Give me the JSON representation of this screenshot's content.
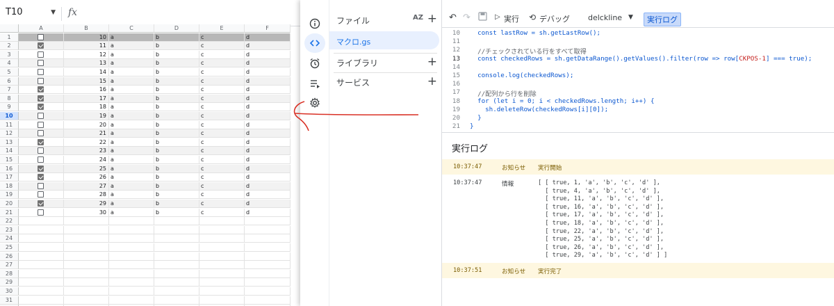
{
  "sheet": {
    "name_box": "T10",
    "fx": "fx",
    "columns": [
      "A",
      "B",
      "C",
      "D",
      "E",
      "F"
    ],
    "rows": [
      {
        "n": "1",
        "checked": false,
        "b": "10",
        "c": "a",
        "d": "b",
        "e": "c",
        "f": "d"
      },
      {
        "n": "2",
        "checked": true,
        "b": "11",
        "c": "a",
        "d": "b",
        "e": "c",
        "f": "d"
      },
      {
        "n": "3",
        "checked": false,
        "b": "12",
        "c": "a",
        "d": "b",
        "e": "c",
        "f": "d"
      },
      {
        "n": "4",
        "checked": false,
        "b": "13",
        "c": "a",
        "d": "b",
        "e": "c",
        "f": "d"
      },
      {
        "n": "5",
        "checked": false,
        "b": "14",
        "c": "a",
        "d": "b",
        "e": "c",
        "f": "d"
      },
      {
        "n": "6",
        "checked": false,
        "b": "15",
        "c": "a",
        "d": "b",
        "e": "c",
        "f": "d"
      },
      {
        "n": "7",
        "checked": true,
        "b": "16",
        "c": "a",
        "d": "b",
        "e": "c",
        "f": "d"
      },
      {
        "n": "8",
        "checked": true,
        "b": "17",
        "c": "a",
        "d": "b",
        "e": "c",
        "f": "d"
      },
      {
        "n": "9",
        "checked": true,
        "b": "18",
        "c": "a",
        "d": "b",
        "e": "c",
        "f": "d"
      },
      {
        "n": "10",
        "checked": false,
        "b": "19",
        "c": "a",
        "d": "b",
        "e": "c",
        "f": "d"
      },
      {
        "n": "11",
        "checked": false,
        "b": "20",
        "c": "a",
        "d": "b",
        "e": "c",
        "f": "d"
      },
      {
        "n": "12",
        "checked": false,
        "b": "21",
        "c": "a",
        "d": "b",
        "e": "c",
        "f": "d"
      },
      {
        "n": "13",
        "checked": true,
        "b": "22",
        "c": "a",
        "d": "b",
        "e": "c",
        "f": "d"
      },
      {
        "n": "14",
        "checked": false,
        "b": "23",
        "c": "a",
        "d": "b",
        "e": "c",
        "f": "d"
      },
      {
        "n": "15",
        "checked": false,
        "b": "24",
        "c": "a",
        "d": "b",
        "e": "c",
        "f": "d"
      },
      {
        "n": "16",
        "checked": true,
        "b": "25",
        "c": "a",
        "d": "b",
        "e": "c",
        "f": "d"
      },
      {
        "n": "17",
        "checked": true,
        "b": "26",
        "c": "a",
        "d": "b",
        "e": "c",
        "f": "d"
      },
      {
        "n": "18",
        "checked": false,
        "b": "27",
        "c": "a",
        "d": "b",
        "e": "c",
        "f": "d"
      },
      {
        "n": "19",
        "checked": false,
        "b": "28",
        "c": "a",
        "d": "b",
        "e": "c",
        "f": "d"
      },
      {
        "n": "20",
        "checked": true,
        "b": "29",
        "c": "a",
        "d": "b",
        "e": "c",
        "f": "d"
      },
      {
        "n": "21",
        "checked": false,
        "b": "30",
        "c": "a",
        "d": "b",
        "e": "c",
        "f": "d"
      },
      {
        "n": "22",
        "checked": null,
        "b": "",
        "c": "",
        "d": "",
        "e": "",
        "f": ""
      },
      {
        "n": "23",
        "checked": null,
        "b": "",
        "c": "",
        "d": "",
        "e": "",
        "f": ""
      },
      {
        "n": "24",
        "checked": null,
        "b": "",
        "c": "",
        "d": "",
        "e": "",
        "f": ""
      },
      {
        "n": "25",
        "checked": null,
        "b": "",
        "c": "",
        "d": "",
        "e": "",
        "f": ""
      },
      {
        "n": "26",
        "checked": null,
        "b": "",
        "c": "",
        "d": "",
        "e": "",
        "f": ""
      },
      {
        "n": "27",
        "checked": null,
        "b": "",
        "c": "",
        "d": "",
        "e": "",
        "f": ""
      },
      {
        "n": "28",
        "checked": null,
        "b": "",
        "c": "",
        "d": "",
        "e": "",
        "f": ""
      },
      {
        "n": "29",
        "checked": null,
        "b": "",
        "c": "",
        "d": "",
        "e": "",
        "f": ""
      },
      {
        "n": "30",
        "checked": null,
        "b": "",
        "c": "",
        "d": "",
        "e": "",
        "f": ""
      },
      {
        "n": "31",
        "checked": null,
        "b": "",
        "c": "",
        "d": "",
        "e": "",
        "f": ""
      },
      {
        "n": "32",
        "checked": null,
        "b": "",
        "c": "",
        "d": "",
        "e": "",
        "f": ""
      }
    ]
  },
  "editor": {
    "rail_icons": [
      "info-icon",
      "code-icon",
      "clock-icon",
      "executions-icon",
      "gear-icon"
    ],
    "files": {
      "header": "ファイル",
      "sort_label": "AZ",
      "file_name": "マクロ.gs",
      "libraries_label": "ライブラリ",
      "services_label": "サービス"
    },
    "toolbar": {
      "run_label": "実行",
      "debug_label": "デバッグ",
      "function_name": "delckline",
      "log_label": "実行ログ"
    },
    "code_lines": [
      {
        "num": "10",
        "text": "  const lastRow = sh.getLastRow();",
        "kind": "code"
      },
      {
        "num": "11",
        "text": "",
        "kind": "code"
      },
      {
        "num": "12",
        "text": "  //チェックされている行をすべて取得",
        "kind": "comment"
      },
      {
        "num": "13",
        "text": "  const checkedRows = sh.getDataRange().getValues().filter(row => row[CKPOS-1] === true);",
        "kind": "code"
      },
      {
        "num": "14",
        "text": "",
        "kind": "code"
      },
      {
        "num": "15",
        "text": "  console.log(checkedRows);",
        "kind": "code"
      },
      {
        "num": "16",
        "text": "",
        "kind": "code"
      },
      {
        "num": "17",
        "text": "  //配列から行を削除",
        "kind": "comment"
      },
      {
        "num": "18",
        "text": "  for (let i = 0; i < checkedRows.length; i++) {",
        "kind": "code"
      },
      {
        "num": "19",
        "text": "    sh.deleteRow(checkedRows[i][0]);",
        "kind": "code"
      },
      {
        "num": "20",
        "text": "  }",
        "kind": "code"
      },
      {
        "num": "21",
        "text": "}",
        "kind": "code"
      }
    ],
    "log": {
      "title": "実行ログ",
      "entries": [
        {
          "time": "10:37:47",
          "level": "お知らせ",
          "message": "実行開始",
          "kind": "notice"
        },
        {
          "time": "10:37:47",
          "level": "情報",
          "message": "[ [ true, 1, 'a', 'b', 'c', 'd' ],\n  [ true, 4, 'a', 'b', 'c', 'd' ],\n  [ true, 11, 'a', 'b', 'c', 'd' ],\n  [ true, 16, 'a', 'b', 'c', 'd' ],\n  [ true, 17, 'a', 'b', 'c', 'd' ],\n  [ true, 18, 'a', 'b', 'c', 'd' ],\n  [ true, 22, 'a', 'b', 'c', 'd' ],\n  [ true, 25, 'a', 'b', 'c', 'd' ],\n  [ true, 26, 'a', 'b', 'c', 'd' ],\n  [ true, 29, 'a', 'b', 'c', 'd' ] ]",
          "kind": "info"
        },
        {
          "time": "10:37:51",
          "level": "お知らせ",
          "message": "実行完了",
          "kind": "notice"
        }
      ]
    }
  },
  "colors": {
    "accent": "#1a73e8",
    "annotation": "#d93025",
    "notice_bg": "#fef7e0"
  }
}
